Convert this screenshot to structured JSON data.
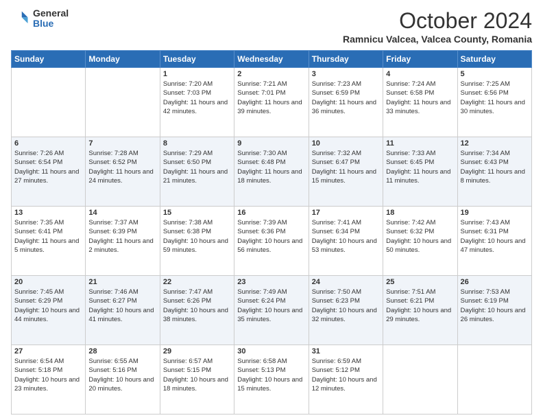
{
  "logo": {
    "general": "General",
    "blue": "Blue"
  },
  "header": {
    "month": "October 2024",
    "location": "Ramnicu Valcea, Valcea County, Romania"
  },
  "days_of_week": [
    "Sunday",
    "Monday",
    "Tuesday",
    "Wednesday",
    "Thursday",
    "Friday",
    "Saturday"
  ],
  "weeks": [
    [
      {
        "day": "",
        "sunrise": "",
        "sunset": "",
        "daylight": ""
      },
      {
        "day": "",
        "sunrise": "",
        "sunset": "",
        "daylight": ""
      },
      {
        "day": "1",
        "sunrise": "Sunrise: 7:20 AM",
        "sunset": "Sunset: 7:03 PM",
        "daylight": "Daylight: 11 hours and 42 minutes."
      },
      {
        "day": "2",
        "sunrise": "Sunrise: 7:21 AM",
        "sunset": "Sunset: 7:01 PM",
        "daylight": "Daylight: 11 hours and 39 minutes."
      },
      {
        "day": "3",
        "sunrise": "Sunrise: 7:23 AM",
        "sunset": "Sunset: 6:59 PM",
        "daylight": "Daylight: 11 hours and 36 minutes."
      },
      {
        "day": "4",
        "sunrise": "Sunrise: 7:24 AM",
        "sunset": "Sunset: 6:58 PM",
        "daylight": "Daylight: 11 hours and 33 minutes."
      },
      {
        "day": "5",
        "sunrise": "Sunrise: 7:25 AM",
        "sunset": "Sunset: 6:56 PM",
        "daylight": "Daylight: 11 hours and 30 minutes."
      }
    ],
    [
      {
        "day": "6",
        "sunrise": "Sunrise: 7:26 AM",
        "sunset": "Sunset: 6:54 PM",
        "daylight": "Daylight: 11 hours and 27 minutes."
      },
      {
        "day": "7",
        "sunrise": "Sunrise: 7:28 AM",
        "sunset": "Sunset: 6:52 PM",
        "daylight": "Daylight: 11 hours and 24 minutes."
      },
      {
        "day": "8",
        "sunrise": "Sunrise: 7:29 AM",
        "sunset": "Sunset: 6:50 PM",
        "daylight": "Daylight: 11 hours and 21 minutes."
      },
      {
        "day": "9",
        "sunrise": "Sunrise: 7:30 AM",
        "sunset": "Sunset: 6:48 PM",
        "daylight": "Daylight: 11 hours and 18 minutes."
      },
      {
        "day": "10",
        "sunrise": "Sunrise: 7:32 AM",
        "sunset": "Sunset: 6:47 PM",
        "daylight": "Daylight: 11 hours and 15 minutes."
      },
      {
        "day": "11",
        "sunrise": "Sunrise: 7:33 AM",
        "sunset": "Sunset: 6:45 PM",
        "daylight": "Daylight: 11 hours and 11 minutes."
      },
      {
        "day": "12",
        "sunrise": "Sunrise: 7:34 AM",
        "sunset": "Sunset: 6:43 PM",
        "daylight": "Daylight: 11 hours and 8 minutes."
      }
    ],
    [
      {
        "day": "13",
        "sunrise": "Sunrise: 7:35 AM",
        "sunset": "Sunset: 6:41 PM",
        "daylight": "Daylight: 11 hours and 5 minutes."
      },
      {
        "day": "14",
        "sunrise": "Sunrise: 7:37 AM",
        "sunset": "Sunset: 6:39 PM",
        "daylight": "Daylight: 11 hours and 2 minutes."
      },
      {
        "day": "15",
        "sunrise": "Sunrise: 7:38 AM",
        "sunset": "Sunset: 6:38 PM",
        "daylight": "Daylight: 10 hours and 59 minutes."
      },
      {
        "day": "16",
        "sunrise": "Sunrise: 7:39 AM",
        "sunset": "Sunset: 6:36 PM",
        "daylight": "Daylight: 10 hours and 56 minutes."
      },
      {
        "day": "17",
        "sunrise": "Sunrise: 7:41 AM",
        "sunset": "Sunset: 6:34 PM",
        "daylight": "Daylight: 10 hours and 53 minutes."
      },
      {
        "day": "18",
        "sunrise": "Sunrise: 7:42 AM",
        "sunset": "Sunset: 6:32 PM",
        "daylight": "Daylight: 10 hours and 50 minutes."
      },
      {
        "day": "19",
        "sunrise": "Sunrise: 7:43 AM",
        "sunset": "Sunset: 6:31 PM",
        "daylight": "Daylight: 10 hours and 47 minutes."
      }
    ],
    [
      {
        "day": "20",
        "sunrise": "Sunrise: 7:45 AM",
        "sunset": "Sunset: 6:29 PM",
        "daylight": "Daylight: 10 hours and 44 minutes."
      },
      {
        "day": "21",
        "sunrise": "Sunrise: 7:46 AM",
        "sunset": "Sunset: 6:27 PM",
        "daylight": "Daylight: 10 hours and 41 minutes."
      },
      {
        "day": "22",
        "sunrise": "Sunrise: 7:47 AM",
        "sunset": "Sunset: 6:26 PM",
        "daylight": "Daylight: 10 hours and 38 minutes."
      },
      {
        "day": "23",
        "sunrise": "Sunrise: 7:49 AM",
        "sunset": "Sunset: 6:24 PM",
        "daylight": "Daylight: 10 hours and 35 minutes."
      },
      {
        "day": "24",
        "sunrise": "Sunrise: 7:50 AM",
        "sunset": "Sunset: 6:23 PM",
        "daylight": "Daylight: 10 hours and 32 minutes."
      },
      {
        "day": "25",
        "sunrise": "Sunrise: 7:51 AM",
        "sunset": "Sunset: 6:21 PM",
        "daylight": "Daylight: 10 hours and 29 minutes."
      },
      {
        "day": "26",
        "sunrise": "Sunrise: 7:53 AM",
        "sunset": "Sunset: 6:19 PM",
        "daylight": "Daylight: 10 hours and 26 minutes."
      }
    ],
    [
      {
        "day": "27",
        "sunrise": "Sunrise: 6:54 AM",
        "sunset": "Sunset: 5:18 PM",
        "daylight": "Daylight: 10 hours and 23 minutes."
      },
      {
        "day": "28",
        "sunrise": "Sunrise: 6:55 AM",
        "sunset": "Sunset: 5:16 PM",
        "daylight": "Daylight: 10 hours and 20 minutes."
      },
      {
        "day": "29",
        "sunrise": "Sunrise: 6:57 AM",
        "sunset": "Sunset: 5:15 PM",
        "daylight": "Daylight: 10 hours and 18 minutes."
      },
      {
        "day": "30",
        "sunrise": "Sunrise: 6:58 AM",
        "sunset": "Sunset: 5:13 PM",
        "daylight": "Daylight: 10 hours and 15 minutes."
      },
      {
        "day": "31",
        "sunrise": "Sunrise: 6:59 AM",
        "sunset": "Sunset: 5:12 PM",
        "daylight": "Daylight: 10 hours and 12 minutes."
      },
      {
        "day": "",
        "sunrise": "",
        "sunset": "",
        "daylight": ""
      },
      {
        "day": "",
        "sunrise": "",
        "sunset": "",
        "daylight": ""
      }
    ]
  ]
}
